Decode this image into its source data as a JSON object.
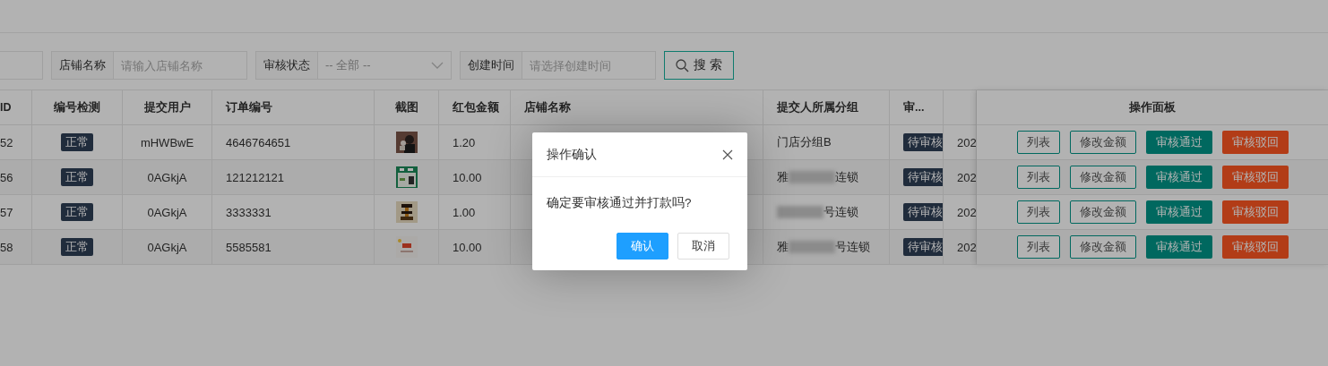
{
  "search": {
    "fields": [
      {
        "kind": "input"
      },
      {
        "kind": "input",
        "label": "店铺名称",
        "placeholder": "请输入店铺名称"
      },
      {
        "kind": "select",
        "label": "审核状态",
        "value": "-- 全部 --"
      },
      {
        "kind": "input",
        "label": "创建时间",
        "placeholder": "请选择创建时间"
      }
    ],
    "button": "搜 索"
  },
  "table": {
    "columns": [
      "ID",
      "编号检测",
      "提交用户",
      "订单编号",
      "截图",
      "红包金额",
      "店铺名称",
      "提交人所属分组",
      "审..."
    ],
    "panel_title": "操作面板",
    "rows": [
      {
        "id": "52",
        "check": "正常",
        "user": "mHWBwE",
        "order": "4646764651",
        "amount": "1.20",
        "group": {
          "before": "门店分组B"
        },
        "status": "待审核",
        "time": "202",
        "actions": [
          {
            "label": "列表",
            "kind": "outline"
          },
          {
            "label": "修改金额",
            "kind": "outline"
          },
          {
            "label": "审核通过",
            "kind": "primary"
          },
          {
            "label": "审核驳回",
            "kind": "danger"
          }
        ]
      },
      {
        "id": "56",
        "check": "正常",
        "user": "0AGkjA",
        "order": "121212121",
        "amount": "10.00",
        "group": {
          "before": "雅",
          "redacted": true,
          "after": "连锁"
        },
        "status": "待审核",
        "time": "202",
        "actions": [
          {
            "label": "列表",
            "kind": "outline"
          },
          {
            "label": "修改金额",
            "kind": "outline"
          },
          {
            "label": "审核通过",
            "kind": "primary"
          },
          {
            "label": "审核驳回",
            "kind": "danger"
          }
        ]
      },
      {
        "id": "57",
        "check": "正常",
        "user": "0AGkjA",
        "order": "3333331",
        "amount": "1.00",
        "group": {
          "redacted": true,
          "after": "号连锁"
        },
        "status": "待审核",
        "time": "202",
        "actions": [
          {
            "label": "列表",
            "kind": "outline"
          },
          {
            "label": "修改金额",
            "kind": "outline"
          },
          {
            "label": "审核通过",
            "kind": "primary"
          },
          {
            "label": "审核驳回",
            "kind": "danger"
          }
        ]
      },
      {
        "id": "58",
        "check": "正常",
        "user": "0AGkjA",
        "order": "5585581",
        "amount": "10.00",
        "group": {
          "before": "雅",
          "redacted": true,
          "after": "号连锁"
        },
        "status": "待审核",
        "time": "202",
        "actions": [
          {
            "label": "列表",
            "kind": "outline"
          },
          {
            "label": "修改金额",
            "kind": "outline"
          },
          {
            "label": "审核通过",
            "kind": "primary"
          },
          {
            "label": "审核驳回",
            "kind": "danger"
          }
        ]
      }
    ]
  },
  "dialog": {
    "title": "操作确认",
    "message": "确定要审核通过并打款吗?",
    "buttons": [
      {
        "label": "确认",
        "kind": "primary"
      },
      {
        "label": "取消",
        "kind": "default"
      }
    ]
  }
}
